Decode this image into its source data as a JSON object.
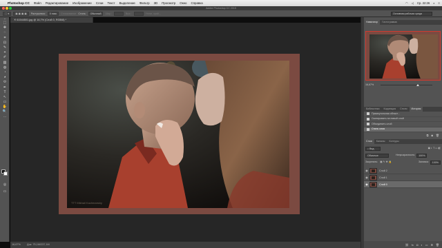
{
  "menubar": {
    "apple": "",
    "app": "Photoshop CC",
    "items": [
      "Файл",
      "Редактирование",
      "Изображение",
      "Слои",
      "Текст",
      "Выделение",
      "Фильтр",
      "3D",
      "Просмотр",
      "Окно",
      "Справка"
    ],
    "clock": "Ср. 22:26"
  },
  "window": {
    "title": "Adobe Photoshop CC 2015"
  },
  "options": {
    "feather_label": "Растушевка:",
    "feather_value": "0 пикс",
    "smooth_label": "Сглаживание",
    "style_label": "Стиль:",
    "style_value": "Обычный",
    "width_label": "Шир.:",
    "height_label": "Выс.:",
    "refine_label": "Уточн. край...",
    "workspace": "Основная рабочая среда"
  },
  "tools": [
    "⬚",
    "✥",
    "◌",
    "⌗",
    "⊡",
    "✎",
    "⌖",
    "✐",
    "▨",
    "◍",
    "◔",
    "◕",
    "⬭",
    "✒",
    "T",
    "↖",
    "▭",
    "✋",
    "🔍",
    "⋯"
  ],
  "document": {
    "tab": "61544501.jpg @ 16,7% (Слой 0, RGB/8) *",
    "watermark": "TTT Mikhail Kachmarskiy"
  },
  "status": {
    "zoom": "16,67%",
    "doc": "Док: 75,1M/237,1M"
  },
  "navigator": {
    "tabs": [
      "Навигатор",
      "Гистограмма"
    ],
    "zoom": "16,67%"
  },
  "history": {
    "tabs": [
      "Библиотеки",
      "Коррекция",
      "Стили",
      "История"
    ],
    "items": [
      "Прямоугольная област...",
      "Скопировать на новый слой",
      "Объединить слой",
      "Стиль слоя"
    ]
  },
  "layers": {
    "tabs": [
      "Слои",
      "Каналы",
      "Контуры"
    ],
    "filter": "Вид",
    "blend": "Обычные",
    "opacity_label": "Непрозрачность:",
    "opacity_value": "100%",
    "lock_label": "Закрепить:",
    "fill_label": "Заливка:",
    "fill_value": "100%",
    "items": [
      "Слой 2",
      "Слой 1",
      "Слой 0"
    ]
  },
  "colors": {
    "frame": "#7b4a41",
    "accent": "#d03a2f"
  }
}
